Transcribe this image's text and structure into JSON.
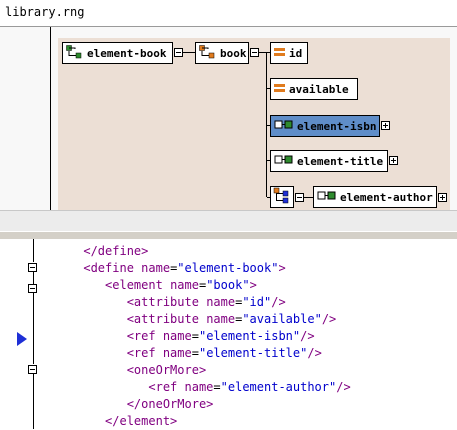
{
  "tab": {
    "title": "library.rng"
  },
  "colors": {
    "canvas": "#ecdfd5",
    "selected": "#5f8dc8",
    "tag": "#800080",
    "value": "#0000cc",
    "breakpoint": "#1e2fd6"
  },
  "diagram": {
    "nodes": {
      "element_book": "element-book",
      "book": "book",
      "id": "id",
      "available": "available",
      "element_isbn": "element-isbn",
      "element_title": "element-title",
      "element_author": "element-author"
    }
  },
  "editor": {
    "lines": [
      {
        "indent": "      ",
        "parts": [
          [
            "tag",
            "</define>"
          ]
        ]
      },
      {
        "indent": "      ",
        "parts": [
          [
            "tag",
            "<define "
          ],
          [
            "attr",
            "name"
          ],
          [
            "eq",
            "="
          ],
          [
            "val",
            "\"element-book\""
          ],
          [
            "tag",
            ">"
          ]
        ]
      },
      {
        "indent": "         ",
        "parts": [
          [
            "tag",
            "<element "
          ],
          [
            "attr",
            "name"
          ],
          [
            "eq",
            "="
          ],
          [
            "val",
            "\"book\""
          ],
          [
            "tag",
            ">"
          ]
        ]
      },
      {
        "indent": "            ",
        "parts": [
          [
            "tag",
            "<attribute "
          ],
          [
            "attr",
            "name"
          ],
          [
            "eq",
            "="
          ],
          [
            "val",
            "\"id\""
          ],
          [
            "tag",
            "/>"
          ]
        ]
      },
      {
        "indent": "            ",
        "parts": [
          [
            "tag",
            "<attribute "
          ],
          [
            "attr",
            "name"
          ],
          [
            "eq",
            "="
          ],
          [
            "val",
            "\"available\""
          ],
          [
            "tag",
            "/>"
          ]
        ]
      },
      {
        "indent": "            ",
        "parts": [
          [
            "tag",
            "<ref "
          ],
          [
            "attr",
            "name"
          ],
          [
            "eq",
            "="
          ],
          [
            "val",
            "\"element-isbn\""
          ],
          [
            "tag",
            "/>"
          ]
        ]
      },
      {
        "indent": "            ",
        "parts": [
          [
            "tag",
            "<ref "
          ],
          [
            "attr",
            "name"
          ],
          [
            "eq",
            "="
          ],
          [
            "val",
            "\"element-title\""
          ],
          [
            "tag",
            "/>"
          ]
        ]
      },
      {
        "indent": "            ",
        "parts": [
          [
            "tag",
            "<oneOrMore>"
          ]
        ]
      },
      {
        "indent": "               ",
        "parts": [
          [
            "tag",
            "<ref "
          ],
          [
            "attr",
            "name"
          ],
          [
            "eq",
            "="
          ],
          [
            "val",
            "\"element-author\""
          ],
          [
            "tag",
            "/>"
          ]
        ]
      },
      {
        "indent": "            ",
        "parts": [
          [
            "tag",
            "</oneOrMore>"
          ]
        ]
      },
      {
        "indent": "         ",
        "parts": [
          [
            "tag",
            "</element>"
          ]
        ]
      }
    ]
  }
}
